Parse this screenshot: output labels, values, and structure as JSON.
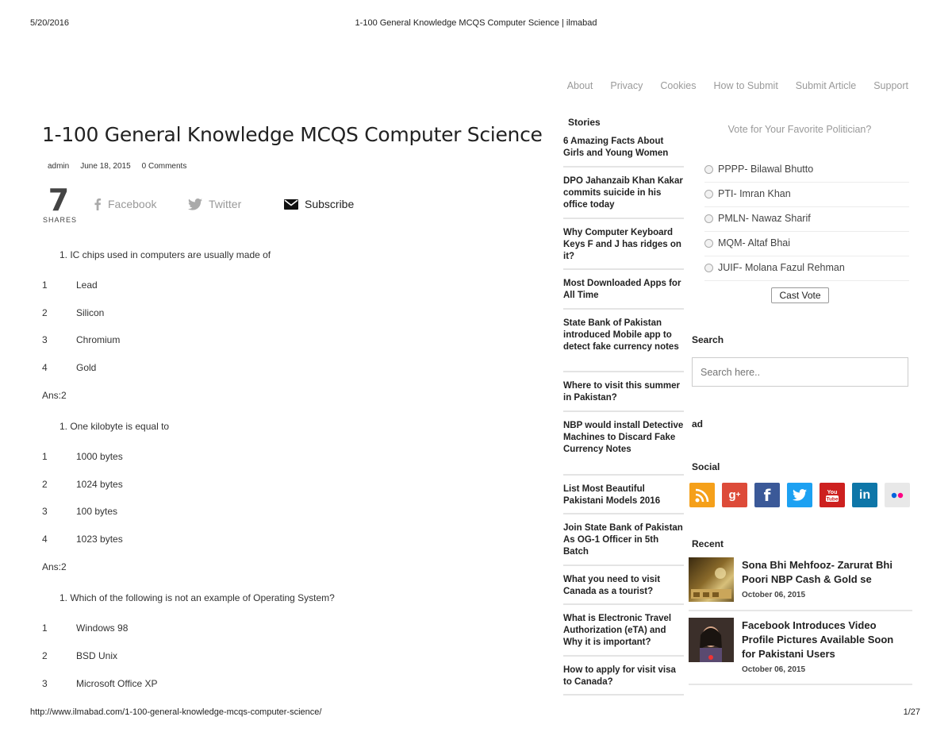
{
  "print": {
    "date": "5/20/2016",
    "title": "1-100 General Knowledge MCQS Computer Science | ilmabad",
    "url": "http://www.ilmabad.com/1-100-general-knowledge-mcqs-computer-science/",
    "page": "1/27"
  },
  "nav": [
    "About",
    "Privacy",
    "Cookies",
    "How to Submit",
    "Submit Article",
    "Support"
  ],
  "article": {
    "title": "1-100 General Knowledge MCQS Computer Science",
    "author": "admin",
    "date": "June 18, 2015",
    "comments": "0 Comments",
    "share_count": "7",
    "share_label": "SHARES",
    "facebook": "Facebook",
    "twitter": "Twitter",
    "subscribe": "Subscribe",
    "questions": [
      {
        "q": "1. IC chips used in computers are usually made of",
        "options": [
          {
            "n": "1",
            "t": "Lead"
          },
          {
            "n": "2",
            "t": "Silicon"
          },
          {
            "n": "3",
            "t": "Chromium"
          },
          {
            "n": "4",
            "t": "Gold"
          }
        ],
        "ans": "Ans:2"
      },
      {
        "q": "1. One kilobyte is equal to",
        "options": [
          {
            "n": "1",
            "t": "1000 bytes"
          },
          {
            "n": "2",
            "t": "1024 bytes"
          },
          {
            "n": "3",
            "t": "100 bytes"
          },
          {
            "n": "4",
            "t": "1023 bytes"
          }
        ],
        "ans": "Ans:2"
      },
      {
        "q": "1. Which of the following is not an example of Operating System?",
        "options": [
          {
            "n": "1",
            "t": "Windows 98"
          },
          {
            "n": "2",
            "t": "BSD Unix"
          },
          {
            "n": "3",
            "t": "Microsoft Office XP"
          }
        ]
      }
    ]
  },
  "stories": {
    "heading": "Stories",
    "items": [
      "6 Amazing Facts About Girls and Young Women",
      "DPO Jahanzaib Khan Kakar commits suicide in his office today",
      "Why Computer Keyboard Keys F and J has ridges on it?",
      "Most Downloaded Apps for All Time",
      "State Bank of Pakistan introduced Mobile app to detect fake currency notes",
      "Where to visit this summer in Pakistan?",
      "NBP would install Detective Machines to Discard Fake Currency Notes",
      "List Most Beautiful Pakistani Models 2016",
      "Join State Bank of Pakistan As OG-1 Officer in 5th Batch",
      "What you need to visit Canada as a tourist?",
      "What is Electronic Travel Authorization (eTA) and Why it is important?",
      "How to apply for visit visa to Canada?"
    ]
  },
  "poll": {
    "question": "Vote for Your Favorite Politician?",
    "options": [
      "PPPP- Bilawal Bhutto",
      "PTI- Imran Khan",
      "PMLN- Nawaz Sharif",
      "MQM- Altaf Bhai",
      "JUIF- Molana Fazul Rehman"
    ],
    "button": "Cast Vote"
  },
  "search": {
    "heading": "Search",
    "placeholder": "Search here.."
  },
  "ad": {
    "heading": "ad"
  },
  "social": {
    "heading": "Social",
    "icons": [
      {
        "name": "rss-icon",
        "color": "#f5a01a"
      },
      {
        "name": "google-plus-icon",
        "color": "#dd4b39"
      },
      {
        "name": "facebook-icon",
        "color": "#3b5998"
      },
      {
        "name": "twitter-icon",
        "color": "#1da1f2"
      },
      {
        "name": "youtube-icon",
        "color": "#cd201f"
      },
      {
        "name": "linkedin-icon",
        "color": "#0e76a8"
      },
      {
        "name": "flickr-icon",
        "color": "#e8e8e8"
      }
    ]
  },
  "recent": {
    "heading": "Recent",
    "items": [
      {
        "title": "Sona Bhi Mehfooz- Zarurat Bhi Poori NBP Cash & Gold se",
        "date": "October 06, 2015"
      },
      {
        "title": "Facebook Introduces Video Profile Pictures Available Soon for Pakistani Users",
        "date": "October 06, 2015"
      }
    ]
  }
}
